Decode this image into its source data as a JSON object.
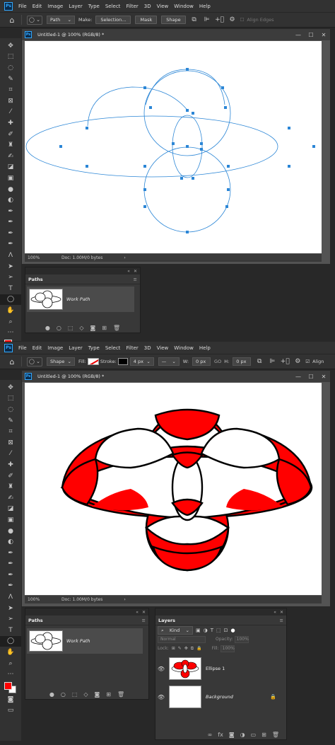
{
  "menu": {
    "app_icon": "Ps",
    "items": [
      "File",
      "Edit",
      "Image",
      "Layer",
      "Type",
      "Select",
      "Filter",
      "3D",
      "View",
      "Window",
      "Help"
    ]
  },
  "top_options": {
    "mode_value": "Path",
    "make_label": "Make:",
    "selection_button": "Selection...",
    "mask_button": "Mask",
    "shape_button": "Shape",
    "align_edges_label": "Align Edges"
  },
  "bottom_options": {
    "mode_value": "Shape",
    "fill_label": "Fill:",
    "stroke_label": "Stroke:",
    "stroke_width": "4 px",
    "w_label": "W:",
    "w_value": "0 px",
    "link_icon": "GO",
    "h_label": "H:",
    "h_value": "0 px",
    "align_label": "Align"
  },
  "document": {
    "title": "Untitled-1 @ 100% (RGB/8) *",
    "zoom": "100%",
    "doc_info": "Doc: 1.00M/0 bytes",
    "arrow": "›"
  },
  "paths_panel": {
    "tab_label": "Paths",
    "path_name": "Work Path"
  },
  "layers_panel": {
    "tab_label": "Layers",
    "filter_kind": "Kind",
    "blend_mode": "Normal",
    "opacity_label": "Opacity:",
    "opacity_value": "100%",
    "lock_label": "Lock:",
    "fill_label": "Fill:",
    "fill_value": "100%",
    "layers": [
      {
        "name": "Ellipse 1",
        "italic": false
      },
      {
        "name": "Background",
        "italic": true
      }
    ]
  },
  "colors": {
    "foreground": "#ff0000",
    "background": "#ffffff",
    "path_stroke": "#2b86d6",
    "shape_fill": "#ff0000",
    "shape_stroke": "#000000"
  },
  "tools": [
    "move-icon",
    "marquee-icon",
    "lasso-icon",
    "quick-select-icon",
    "crop-icon",
    "frame-icon",
    "eyedropper-icon",
    "healing-icon",
    "brush-icon",
    "stamp-icon",
    "history-brush-icon",
    "eraser-icon",
    "gradient-icon",
    "blur-icon",
    "dodge-icon",
    "pen-icon",
    "freeform-pen-icon",
    "curvature-pen-icon",
    "add-anchor-icon",
    "convert-point-icon",
    "path-select-icon",
    "direct-select-icon",
    "type-icon",
    "ellipse-tool-icon",
    "hand-icon",
    "zoom-icon"
  ]
}
